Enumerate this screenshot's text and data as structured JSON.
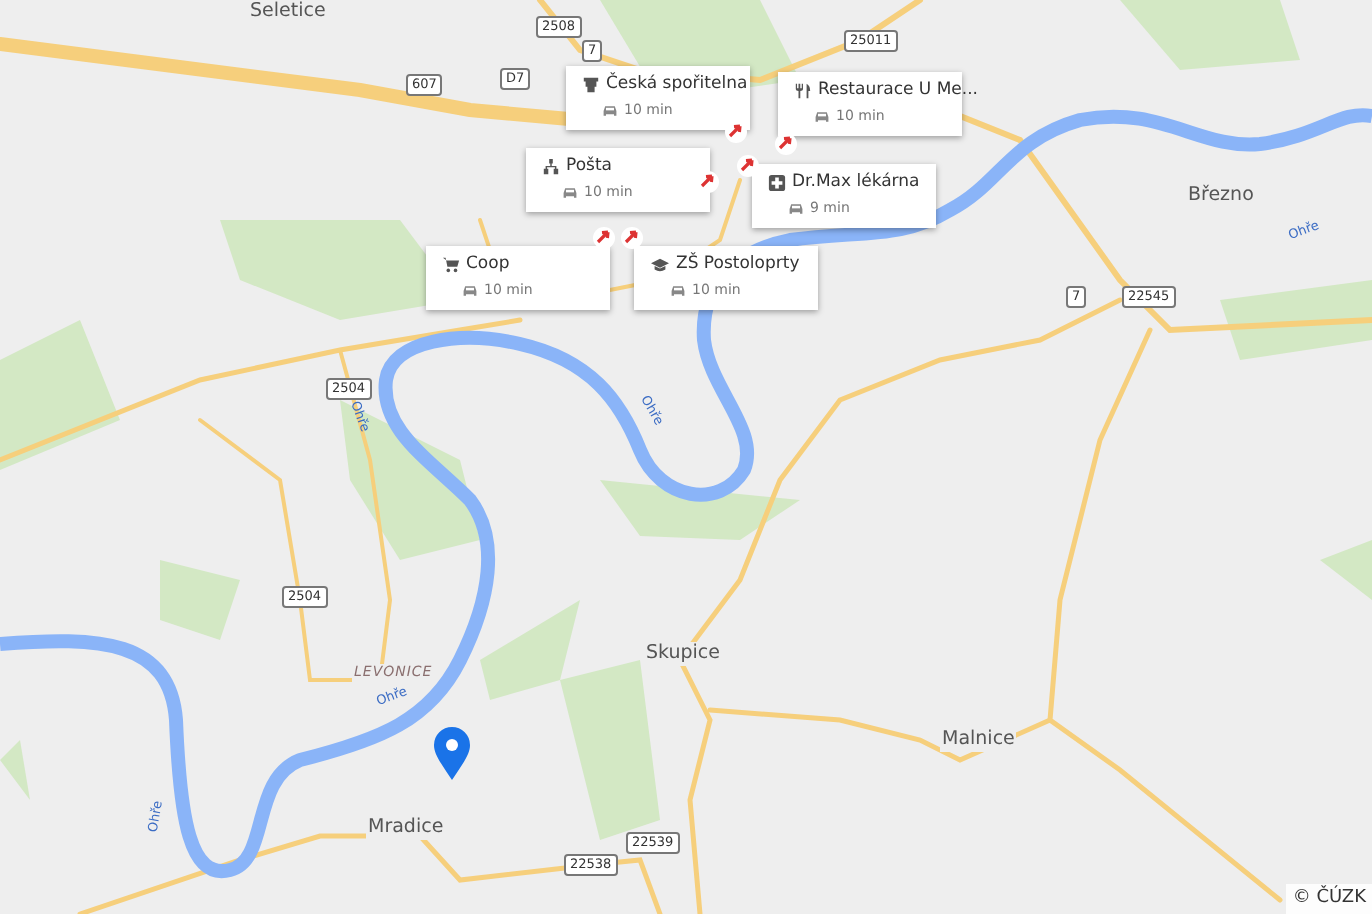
{
  "places": [
    {
      "name": "Seletice",
      "kind": "town"
    },
    {
      "name": "Březno",
      "kind": "town"
    },
    {
      "name": "Skupice",
      "kind": "town"
    },
    {
      "name": "Malnice",
      "kind": "town"
    },
    {
      "name": "Mradice",
      "kind": "town"
    },
    {
      "name": "LEVONICE",
      "kind": "district"
    }
  ],
  "road_shields": [
    "2508",
    "607",
    "D7",
    "7",
    "25011",
    "7",
    "22545",
    "2504",
    "2504",
    "22539",
    "22538"
  ],
  "river_labels": [
    "Ohře",
    "Ohře",
    "Ohře",
    "Ohře",
    "Ohře"
  ],
  "pois": [
    {
      "kind": "bank",
      "name": "Česká spořitelna",
      "travel_time": "10 min"
    },
    {
      "kind": "restaurant",
      "name": "Restaurace U Me...",
      "travel_time": "10 min"
    },
    {
      "kind": "post",
      "name": "Pošta",
      "travel_time": "10 min"
    },
    {
      "kind": "pharmacy",
      "name": "Dr.Max lékárna",
      "travel_time": "9 min"
    },
    {
      "kind": "shop",
      "name": "Coop",
      "travel_time": "10 min"
    },
    {
      "kind": "school",
      "name": "ZŠ Postoloprty",
      "travel_time": "10 min"
    }
  ],
  "attribution": "© ČÚZK"
}
